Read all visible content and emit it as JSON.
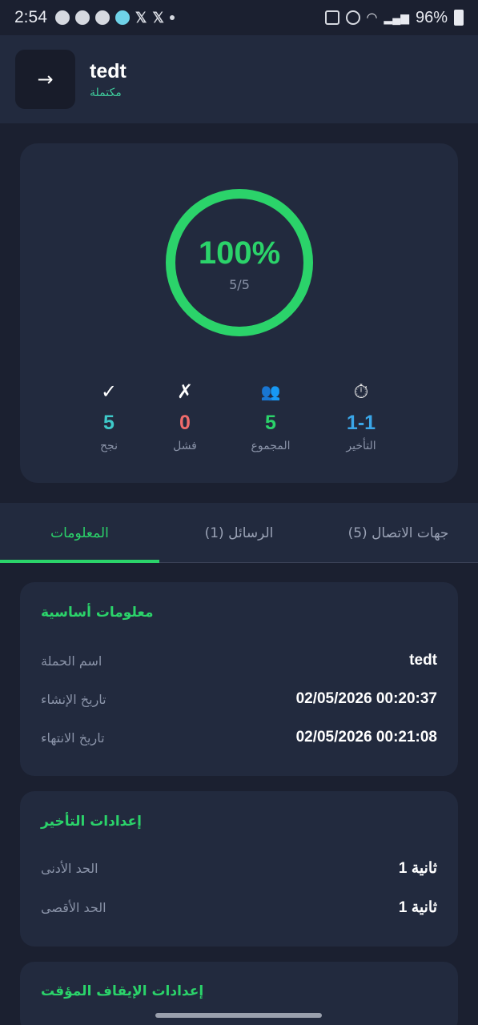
{
  "status_bar": {
    "time": "2:54",
    "battery": "96%"
  },
  "header": {
    "back_icon": "arrow-right-icon",
    "back_glyph": "→",
    "title": "tedt",
    "status": "مكتملة"
  },
  "progress": {
    "percent_text": "100%",
    "fraction": "5/5",
    "percent_value": 1.0,
    "color": "#2bd36a",
    "stats": [
      {
        "icon": "checkmark-icon",
        "glyph": "✓",
        "value": "5",
        "label": "نجح",
        "color": "#3ec9c9"
      },
      {
        "icon": "cross-icon",
        "glyph": "✗",
        "value": "0",
        "label": "فشل",
        "color": "#f06b6b"
      },
      {
        "icon": "group-icon",
        "glyph": "👥",
        "value": "5",
        "label": "المجموع",
        "color": "#2bd36a"
      },
      {
        "icon": "stopwatch-icon",
        "glyph": "⏱",
        "value": "1-1",
        "label": "التأخير",
        "color": "#3aa6e8"
      }
    ]
  },
  "tabs": [
    {
      "label": "المعلومات",
      "active": true
    },
    {
      "label": "الرسائل (1)",
      "active": false
    },
    {
      "label": "جهات الاتصال (5)",
      "active": false
    }
  ],
  "basic_info": {
    "title": "معلومات أساسية",
    "rows": [
      {
        "label": "اسم الحملة",
        "value": "tedt"
      },
      {
        "label": "تاريخ الإنشاء",
        "value": "02/05/2026 00:20:37"
      },
      {
        "label": "تاريخ الانتهاء",
        "value": "02/05/2026 00:21:08"
      }
    ]
  },
  "delay_settings": {
    "title": "إعدادات التأخير",
    "rows": [
      {
        "label": "الحد الأدنى",
        "value": "1 ثانية"
      },
      {
        "label": "الحد الأقصى",
        "value": "1 ثانية"
      }
    ]
  },
  "pause_settings": {
    "title": "إعدادات الإيقاف المؤقت"
  }
}
